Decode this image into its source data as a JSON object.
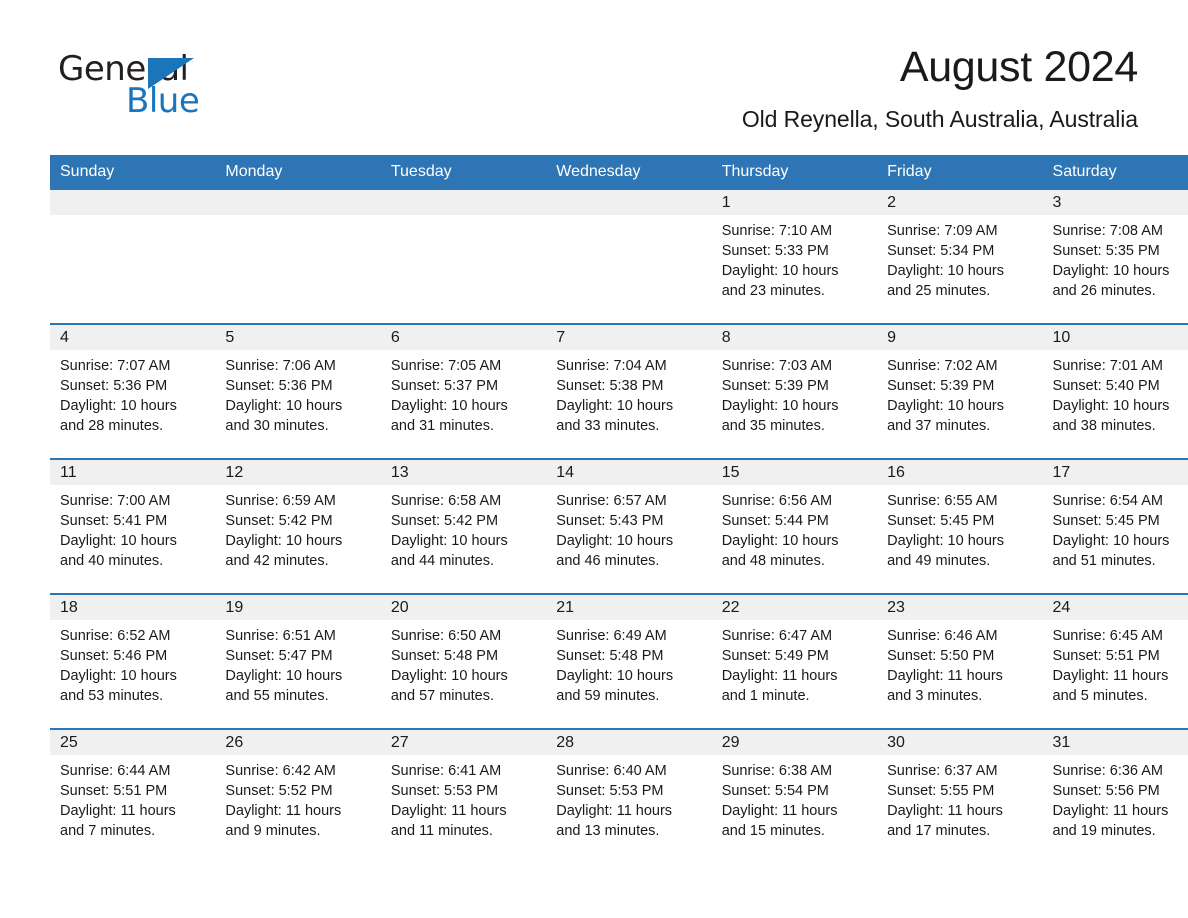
{
  "logo": {
    "word1": "General",
    "word2": "Blue",
    "triangle_color": "#1b75bb",
    "icon": "triangle-logo-icon"
  },
  "header": {
    "title": "August 2024",
    "subtitle": "Old Reynella, South Australia, Australia"
  },
  "theme": {
    "header_blue": "#2e75b6",
    "daynum_band": "#f0f0f0",
    "text": "#1a1a1a"
  },
  "calendar": {
    "weekday_headers": [
      "Sunday",
      "Monday",
      "Tuesday",
      "Wednesday",
      "Thursday",
      "Friday",
      "Saturday"
    ],
    "weeks": [
      [
        {
          "day": "",
          "sunrise": "",
          "sunset": "",
          "daylight1": "",
          "daylight2": ""
        },
        {
          "day": "",
          "sunrise": "",
          "sunset": "",
          "daylight1": "",
          "daylight2": ""
        },
        {
          "day": "",
          "sunrise": "",
          "sunset": "",
          "daylight1": "",
          "daylight2": ""
        },
        {
          "day": "",
          "sunrise": "",
          "sunset": "",
          "daylight1": "",
          "daylight2": ""
        },
        {
          "day": "1",
          "sunrise": "Sunrise: 7:10 AM",
          "sunset": "Sunset: 5:33 PM",
          "daylight1": "Daylight: 10 hours",
          "daylight2": "and 23 minutes."
        },
        {
          "day": "2",
          "sunrise": "Sunrise: 7:09 AM",
          "sunset": "Sunset: 5:34 PM",
          "daylight1": "Daylight: 10 hours",
          "daylight2": "and 25 minutes."
        },
        {
          "day": "3",
          "sunrise": "Sunrise: 7:08 AM",
          "sunset": "Sunset: 5:35 PM",
          "daylight1": "Daylight: 10 hours",
          "daylight2": "and 26 minutes."
        }
      ],
      [
        {
          "day": "4",
          "sunrise": "Sunrise: 7:07 AM",
          "sunset": "Sunset: 5:36 PM",
          "daylight1": "Daylight: 10 hours",
          "daylight2": "and 28 minutes."
        },
        {
          "day": "5",
          "sunrise": "Sunrise: 7:06 AM",
          "sunset": "Sunset: 5:36 PM",
          "daylight1": "Daylight: 10 hours",
          "daylight2": "and 30 minutes."
        },
        {
          "day": "6",
          "sunrise": "Sunrise: 7:05 AM",
          "sunset": "Sunset: 5:37 PM",
          "daylight1": "Daylight: 10 hours",
          "daylight2": "and 31 minutes."
        },
        {
          "day": "7",
          "sunrise": "Sunrise: 7:04 AM",
          "sunset": "Sunset: 5:38 PM",
          "daylight1": "Daylight: 10 hours",
          "daylight2": "and 33 minutes."
        },
        {
          "day": "8",
          "sunrise": "Sunrise: 7:03 AM",
          "sunset": "Sunset: 5:39 PM",
          "daylight1": "Daylight: 10 hours",
          "daylight2": "and 35 minutes."
        },
        {
          "day": "9",
          "sunrise": "Sunrise: 7:02 AM",
          "sunset": "Sunset: 5:39 PM",
          "daylight1": "Daylight: 10 hours",
          "daylight2": "and 37 minutes."
        },
        {
          "day": "10",
          "sunrise": "Sunrise: 7:01 AM",
          "sunset": "Sunset: 5:40 PM",
          "daylight1": "Daylight: 10 hours",
          "daylight2": "and 38 minutes."
        }
      ],
      [
        {
          "day": "11",
          "sunrise": "Sunrise: 7:00 AM",
          "sunset": "Sunset: 5:41 PM",
          "daylight1": "Daylight: 10 hours",
          "daylight2": "and 40 minutes."
        },
        {
          "day": "12",
          "sunrise": "Sunrise: 6:59 AM",
          "sunset": "Sunset: 5:42 PM",
          "daylight1": "Daylight: 10 hours",
          "daylight2": "and 42 minutes."
        },
        {
          "day": "13",
          "sunrise": "Sunrise: 6:58 AM",
          "sunset": "Sunset: 5:42 PM",
          "daylight1": "Daylight: 10 hours",
          "daylight2": "and 44 minutes."
        },
        {
          "day": "14",
          "sunrise": "Sunrise: 6:57 AM",
          "sunset": "Sunset: 5:43 PM",
          "daylight1": "Daylight: 10 hours",
          "daylight2": "and 46 minutes."
        },
        {
          "day": "15",
          "sunrise": "Sunrise: 6:56 AM",
          "sunset": "Sunset: 5:44 PM",
          "daylight1": "Daylight: 10 hours",
          "daylight2": "and 48 minutes."
        },
        {
          "day": "16",
          "sunrise": "Sunrise: 6:55 AM",
          "sunset": "Sunset: 5:45 PM",
          "daylight1": "Daylight: 10 hours",
          "daylight2": "and 49 minutes."
        },
        {
          "day": "17",
          "sunrise": "Sunrise: 6:54 AM",
          "sunset": "Sunset: 5:45 PM",
          "daylight1": "Daylight: 10 hours",
          "daylight2": "and 51 minutes."
        }
      ],
      [
        {
          "day": "18",
          "sunrise": "Sunrise: 6:52 AM",
          "sunset": "Sunset: 5:46 PM",
          "daylight1": "Daylight: 10 hours",
          "daylight2": "and 53 minutes."
        },
        {
          "day": "19",
          "sunrise": "Sunrise: 6:51 AM",
          "sunset": "Sunset: 5:47 PM",
          "daylight1": "Daylight: 10 hours",
          "daylight2": "and 55 minutes."
        },
        {
          "day": "20",
          "sunrise": "Sunrise: 6:50 AM",
          "sunset": "Sunset: 5:48 PM",
          "daylight1": "Daylight: 10 hours",
          "daylight2": "and 57 minutes."
        },
        {
          "day": "21",
          "sunrise": "Sunrise: 6:49 AM",
          "sunset": "Sunset: 5:48 PM",
          "daylight1": "Daylight: 10 hours",
          "daylight2": "and 59 minutes."
        },
        {
          "day": "22",
          "sunrise": "Sunrise: 6:47 AM",
          "sunset": "Sunset: 5:49 PM",
          "daylight1": "Daylight: 11 hours",
          "daylight2": "and 1 minute."
        },
        {
          "day": "23",
          "sunrise": "Sunrise: 6:46 AM",
          "sunset": "Sunset: 5:50 PM",
          "daylight1": "Daylight: 11 hours",
          "daylight2": "and 3 minutes."
        },
        {
          "day": "24",
          "sunrise": "Sunrise: 6:45 AM",
          "sunset": "Sunset: 5:51 PM",
          "daylight1": "Daylight: 11 hours",
          "daylight2": "and 5 minutes."
        }
      ],
      [
        {
          "day": "25",
          "sunrise": "Sunrise: 6:44 AM",
          "sunset": "Sunset: 5:51 PM",
          "daylight1": "Daylight: 11 hours",
          "daylight2": "and 7 minutes."
        },
        {
          "day": "26",
          "sunrise": "Sunrise: 6:42 AM",
          "sunset": "Sunset: 5:52 PM",
          "daylight1": "Daylight: 11 hours",
          "daylight2": "and 9 minutes."
        },
        {
          "day": "27",
          "sunrise": "Sunrise: 6:41 AM",
          "sunset": "Sunset: 5:53 PM",
          "daylight1": "Daylight: 11 hours",
          "daylight2": "and 11 minutes."
        },
        {
          "day": "28",
          "sunrise": "Sunrise: 6:40 AM",
          "sunset": "Sunset: 5:53 PM",
          "daylight1": "Daylight: 11 hours",
          "daylight2": "and 13 minutes."
        },
        {
          "day": "29",
          "sunrise": "Sunrise: 6:38 AM",
          "sunset": "Sunset: 5:54 PM",
          "daylight1": "Daylight: 11 hours",
          "daylight2": "and 15 minutes."
        },
        {
          "day": "30",
          "sunrise": "Sunrise: 6:37 AM",
          "sunset": "Sunset: 5:55 PM",
          "daylight1": "Daylight: 11 hours",
          "daylight2": "and 17 minutes."
        },
        {
          "day": "31",
          "sunrise": "Sunrise: 6:36 AM",
          "sunset": "Sunset: 5:56 PM",
          "daylight1": "Daylight: 11 hours",
          "daylight2": "and 19 minutes."
        }
      ]
    ]
  }
}
